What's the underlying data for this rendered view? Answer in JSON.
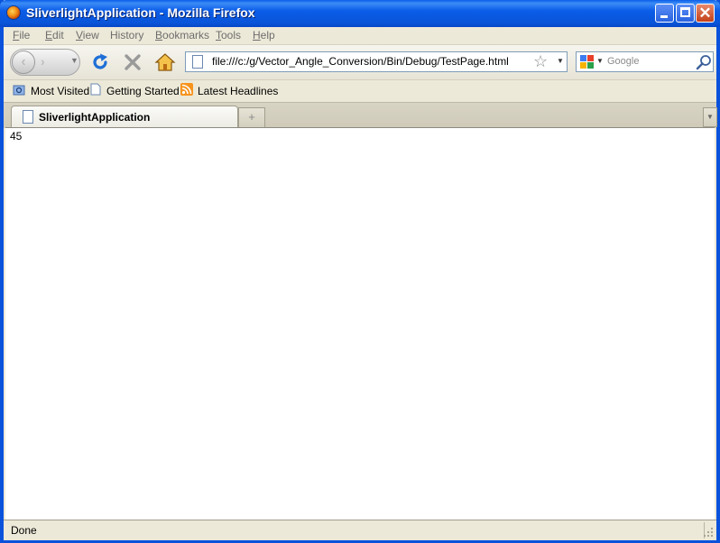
{
  "window": {
    "title": "SliverlightApplication - Mozilla Firefox",
    "min_label": "",
    "max_label": "",
    "close_label": "✕"
  },
  "menu": {
    "file": {
      "accel": "F",
      "rest": "ile"
    },
    "edit": {
      "accel": "E",
      "rest": "dit"
    },
    "view": {
      "accel": "V",
      "rest": "iew"
    },
    "history": {
      "accel": "",
      "rest": "History"
    },
    "bookmarks": {
      "accel": "B",
      "rest": "ookmarks"
    },
    "tools": {
      "accel": "T",
      "rest": "ools"
    },
    "help": {
      "accel": "H",
      "rest": "elp"
    }
  },
  "nav": {
    "url": "file:///c:/g/Vector_Angle_Conversion/Bin/Debug/TestPage.html",
    "search_placeholder": "Google"
  },
  "bookmarks": {
    "items": [
      "Most Visited",
      "Getting Started",
      "Latest Headlines"
    ]
  },
  "tabs": {
    "active_label": "SliverlightApplication",
    "new_tab_symbol": "+",
    "list_symbol": "▼"
  },
  "content": {
    "text": "45"
  },
  "status": {
    "text": "Done"
  },
  "colors": {
    "title_bar": "#0a5ee8",
    "close_button": "#c4401a",
    "reload_blue": "#1f6fd6",
    "rss_orange": "#f7941d"
  }
}
